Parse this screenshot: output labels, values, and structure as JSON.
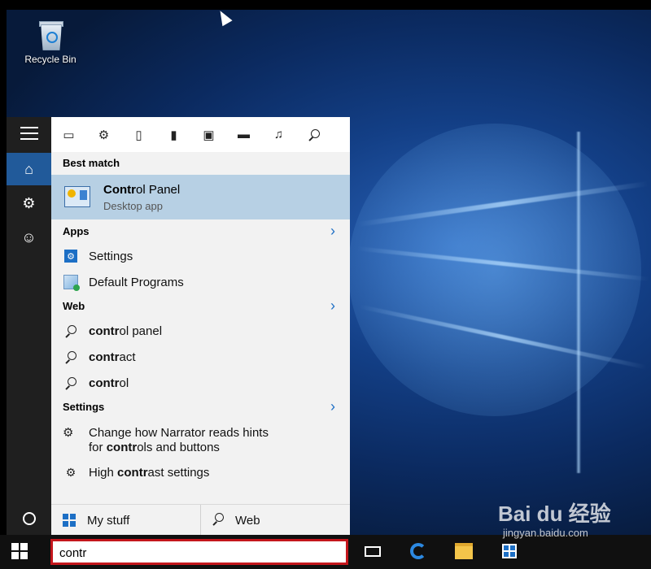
{
  "desktop": {
    "recycle_bin_label": "Recycle Bin"
  },
  "rail": {
    "items": [
      {
        "icon": "hamburger-menu-icon"
      },
      {
        "icon": "home-icon",
        "active": true
      },
      {
        "icon": "gear-icon"
      },
      {
        "icon": "feedback-icon"
      },
      {
        "icon": "cortana-circle-icon"
      }
    ]
  },
  "filters": [
    "apps-filter-icon",
    "settings-filter-icon",
    "documents-filter-icon",
    "tablet-filter-icon",
    "photos-filter-icon",
    "videos-filter-icon",
    "music-filter-icon",
    "web-filter-icon"
  ],
  "best_match": {
    "header": "Best match",
    "title_bold": "Contr",
    "title_rest": "ol Panel",
    "subtitle": "Desktop app"
  },
  "apps": {
    "header": "Apps",
    "items": [
      {
        "label": "Settings",
        "icon": "settings-app-icon"
      },
      {
        "label": "Default Programs",
        "icon": "default-programs-icon"
      }
    ]
  },
  "web": {
    "header": "Web",
    "items": [
      {
        "bold": "contr",
        "rest": "ol panel"
      },
      {
        "bold": "contr",
        "rest": "act"
      },
      {
        "bold": "contr",
        "rest": "ol"
      }
    ]
  },
  "settings_section": {
    "header": "Settings",
    "item1": {
      "line1": "Change how Narrator reads hints",
      "line2_pre": "for ",
      "line2_bold": "contr",
      "line2_rest": "ols and buttons"
    },
    "item2": {
      "pre": "High ",
      "bold": "contr",
      "rest": "ast settings"
    }
  },
  "bottom": {
    "my_stuff": "My stuff",
    "web": "Web"
  },
  "search": {
    "value": "contr"
  },
  "watermark": {
    "line1": "Bai du 经验",
    "line2": "jingyan.baidu.com"
  },
  "colors": {
    "accent": "#1d6fc5",
    "selection": "#b7d0e4",
    "search_border": "#c4161c"
  }
}
